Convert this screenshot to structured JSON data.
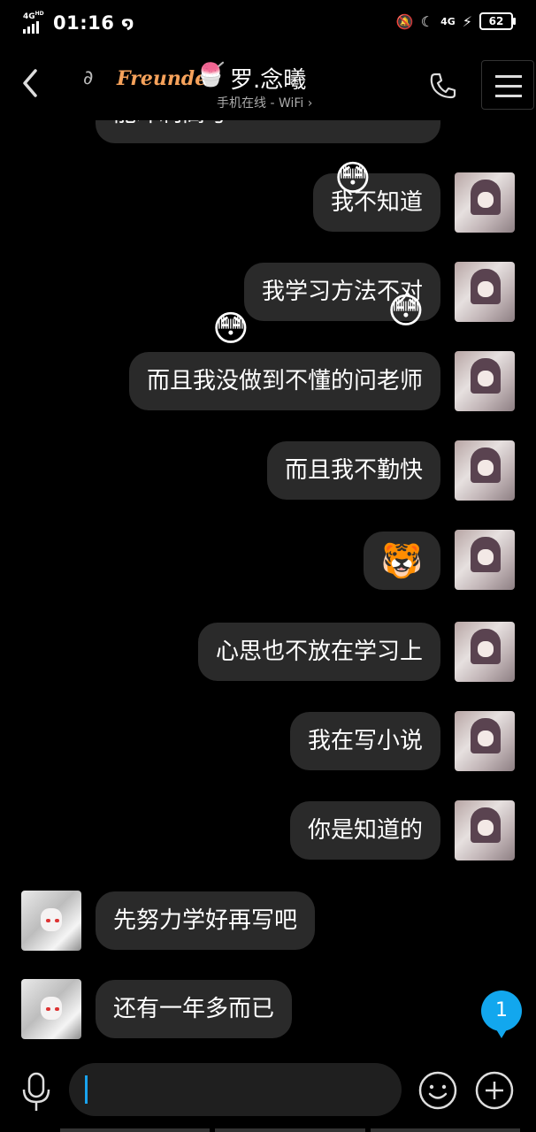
{
  "status_bar": {
    "network_left": "4G",
    "network_left_sup": "HD",
    "time": "01:16",
    "network_right": "4G",
    "battery": "62"
  },
  "header": {
    "freunde_badge": "Freunde",
    "title": "罗.念曦",
    "subtitle": "手机在线 - WiFi ›"
  },
  "messages": [
    {
      "side": "me",
      "text": "能冲刺高考"
    },
    {
      "side": "me",
      "text": "我不知道"
    },
    {
      "side": "me",
      "text": "我学习方法不对"
    },
    {
      "side": "me",
      "text": "而且我没做到不懂的问老师"
    },
    {
      "side": "me",
      "text": "而且我不勤快"
    },
    {
      "side": "me",
      "text": "🐯"
    },
    {
      "side": "me",
      "text": "心思也不放在学习上"
    },
    {
      "side": "me",
      "text": "我在写小说"
    },
    {
      "side": "me",
      "text": "你是知道的"
    },
    {
      "side": "other",
      "text": "先努力学好再写吧"
    },
    {
      "side": "other",
      "text": "还有一年多而已"
    }
  ],
  "floating_emojis": [
    "😳",
    "😳",
    "😳"
  ],
  "unread_count": "1",
  "colors": {
    "background": "#000000",
    "bubble": "#2a2a2a",
    "accent": "#12a7ee",
    "freunde": "#f6a25b"
  },
  "icons": {
    "back": "chevron-left-icon",
    "ear": "ear-icon",
    "call": "phone-icon",
    "menu": "menu-icon",
    "mic": "microphone-icon",
    "emoji": "smiley-icon",
    "plus": "plus-icon"
  }
}
